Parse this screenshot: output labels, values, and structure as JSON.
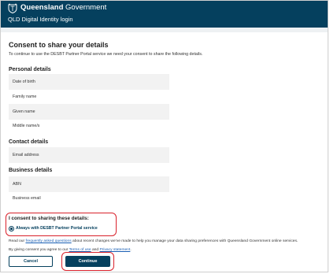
{
  "header": {
    "brand_bold": "Queensland",
    "brand_rest": "Government",
    "subtitle": "QLD Digital Identity login",
    "color": "#05405e"
  },
  "main": {
    "title": "Consent to share your details",
    "intro": "To continue to use the DESBT Partner Portal service we need your consent to share the following details."
  },
  "personal": {
    "heading": "Personal details",
    "fields": [
      "Date of birth",
      "Family name",
      "Given name",
      "Middle name/s"
    ]
  },
  "contact": {
    "heading": "Contact details",
    "fields": [
      "Email address"
    ]
  },
  "business": {
    "heading": "Business details",
    "fields": [
      "ABN",
      "Business email"
    ]
  },
  "consent": {
    "title": "I consent to sharing these details:",
    "option": "Always with DESBT Partner Portal service",
    "selected": true,
    "highlight_color": "#d9212b"
  },
  "footer": {
    "read_prefix": "Read our ",
    "faq_link": "frequently asked questions",
    "read_suffix": " about recent changes we’ve made to help you manage your data sharing preferences with Queensland Government online services.",
    "agree_prefix": "By giving consent you agree to our ",
    "terms_link": "Terms of use",
    "and": " and ",
    "privacy_link": "Privacy statement",
    "period": "."
  },
  "buttons": {
    "cancel": "Cancel",
    "continue": "Continue"
  }
}
